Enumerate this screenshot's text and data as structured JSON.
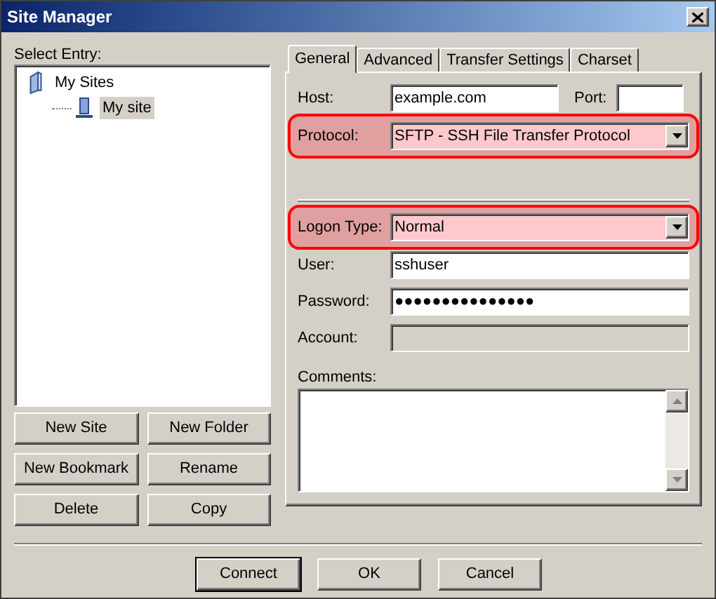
{
  "window": {
    "title": "Site Manager"
  },
  "select_entry_label": "Select Entry:",
  "tree": [
    {
      "label": "My Sites",
      "kind": "folder",
      "selected": false,
      "children": [
        {
          "label": "My site",
          "kind": "site",
          "selected": true
        }
      ]
    }
  ],
  "entry_buttons": [
    "New Site",
    "New Folder",
    "New Bookmark",
    "Rename",
    "Delete",
    "Copy"
  ],
  "tabs": [
    {
      "label": "General",
      "selected": true
    },
    {
      "label": "Advanced",
      "selected": false
    },
    {
      "label": "Transfer Settings",
      "selected": false
    },
    {
      "label": "Charset",
      "selected": false
    }
  ],
  "host": {
    "label": "Host:",
    "value": "example.com"
  },
  "port": {
    "label": "Port:"
  },
  "protocol": {
    "label": "Protocol:",
    "value": "SFTP - SSH File Transfer Protocol",
    "highlighted": true
  },
  "logon_type": {
    "label": "Logon Type:",
    "value": "Normal",
    "highlighted": true
  },
  "user": {
    "label": "User:",
    "value": "sshuser",
    "disabled": false
  },
  "password": {
    "label": "Password:",
    "value": "●●●●●●●●●●●●●●●",
    "disabled": false
  },
  "account": {
    "label": "Account:",
    "disabled": true
  },
  "comments": {
    "label": "Comments:"
  },
  "footer_buttons": [
    {
      "label": "Connect",
      "default": true
    },
    {
      "label": "OK",
      "default": false
    },
    {
      "label": "Cancel",
      "default": false
    }
  ]
}
